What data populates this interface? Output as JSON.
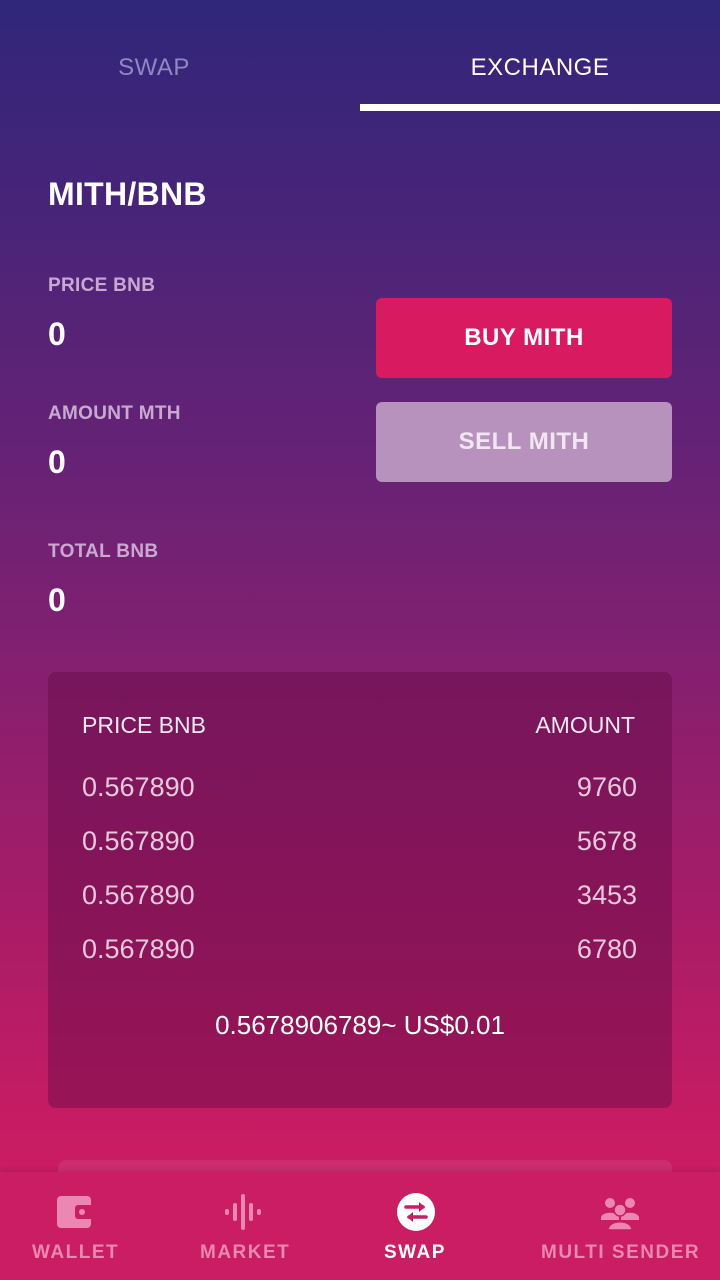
{
  "tabs": {
    "swap": "SWAP",
    "exchange": "EXCHANGE",
    "active": "EXCHANGE"
  },
  "pair": "MITH/BNB",
  "form": {
    "price_label": "PRICE BNB",
    "price_value": "0",
    "amount_label": "AMOUNT MTH",
    "amount_value": "0",
    "total_label": "TOTAL BNB",
    "total_value": "0"
  },
  "buttons": {
    "buy": "BUY MITH",
    "sell": "SELL MITH"
  },
  "order_book": {
    "price_header": "PRICE BNB",
    "amount_header": "AMOUNT",
    "rows": [
      {
        "price": "0.567890",
        "amount": "9760"
      },
      {
        "price": "0.567890",
        "amount": "5678"
      },
      {
        "price": "0.567890",
        "amount": "3453"
      },
      {
        "price": "0.567890",
        "amount": "6780"
      }
    ],
    "summary": "0.5678906789~ US$0.01"
  },
  "bottom_nav": {
    "items": [
      {
        "label": "WALLET",
        "icon": "wallet-icon"
      },
      {
        "label": "MARKET",
        "icon": "market-icon"
      },
      {
        "label": "SWAP",
        "icon": "swap-icon",
        "active": true
      },
      {
        "label": "MULTI SENDER",
        "icon": "users-icon"
      }
    ]
  },
  "colors": {
    "buy_button": "#d81b60",
    "sell_button": "#b692bd",
    "nav_background": "#ca1d63",
    "nav_inactive": "#ec86b2"
  }
}
